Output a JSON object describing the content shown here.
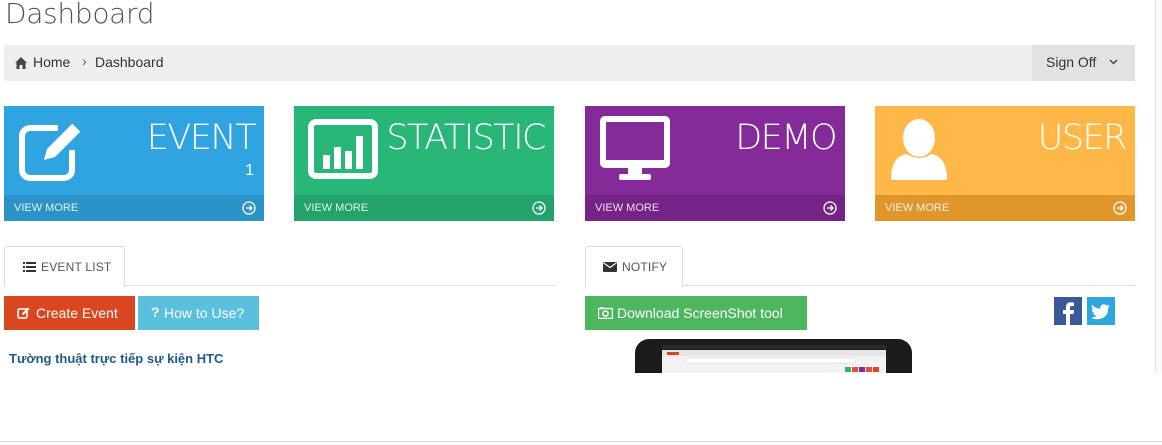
{
  "page": {
    "title": "Dashboard"
  },
  "breadcrumb": {
    "home": "Home",
    "separator": "›",
    "current": "Dashboard"
  },
  "user_menu": {
    "label": "Sign Off"
  },
  "tiles": [
    {
      "title": "EVENT",
      "count": "1",
      "footer": "VIEW MORE",
      "color": "#2fa4e1",
      "footer_color": "#2c93c8",
      "icon": "edit-icon"
    },
    {
      "title": "STATISTIC",
      "count": "",
      "footer": "VIEW MORE",
      "color": "#28b779",
      "footer_color": "#23a36b",
      "icon": "bar-chart-icon"
    },
    {
      "title": "DEMO",
      "count": "",
      "footer": "VIEW MORE",
      "color": "#852b99",
      "footer_color": "#752387",
      "icon": "desktop-icon"
    },
    {
      "title": "USER",
      "count": "",
      "footer": "VIEW MORE",
      "color": "#ffb848",
      "footer_color": "#e0962b",
      "icon": "user-icon"
    }
  ],
  "tabs": {
    "event_list": {
      "label": "EVENT LIST",
      "icon": "list-icon"
    },
    "notify": {
      "label": "NOTIFY",
      "icon": "envelope-icon"
    }
  },
  "buttons": {
    "create_event": {
      "label": "Create Event",
      "color": "#d9461f"
    },
    "how_to_use": {
      "label": "How to Use?",
      "color": "#5bc0de"
    },
    "download_tool": {
      "label": "Download ScreenShot tool",
      "color": "#4cb75e"
    }
  },
  "events": [
    {
      "title": "Tường thuật trực tiếp sự kiện HTC"
    }
  ],
  "social": [
    {
      "name": "facebook-icon",
      "color": "#3b5998"
    },
    {
      "name": "twitter-icon",
      "color": "#2ca7e0"
    }
  ]
}
